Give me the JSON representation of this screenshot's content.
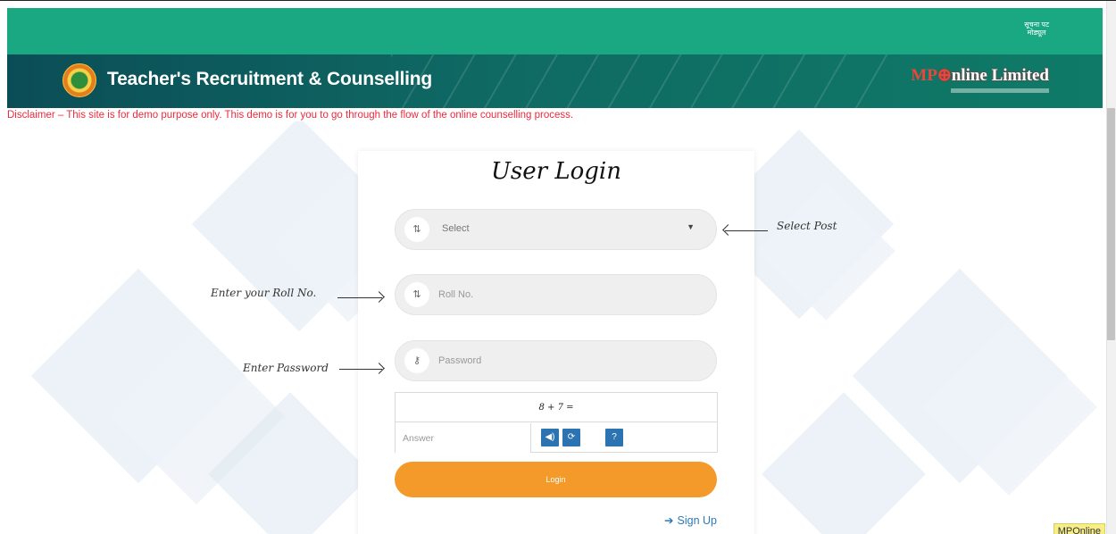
{
  "lang_link": [
    "सूचना पट",
    "मोड्यूल"
  ],
  "header": {
    "title": "Teacher's Recruitment & Counselling",
    "brand": {
      "prefix": "MP",
      "suffix": "nline Limited"
    }
  },
  "disclaimer": "Disclaimer – This site is for demo purpose only. This demo is for you to go through the flow of the online counselling process.",
  "login": {
    "title": "User Login",
    "post_select": {
      "value": "Select",
      "icon": "sort-icon"
    },
    "roll_no": {
      "placeholder": "Roll No.",
      "icon": "sort-icon"
    },
    "password": {
      "placeholder": "Password",
      "icon": "key-icon"
    },
    "captcha": {
      "question": "8 + 7 =",
      "answer_placeholder": "Answer",
      "buttons": [
        "audio-icon",
        "refresh-icon",
        "help-icon"
      ]
    },
    "login_label": "Login",
    "signup_label": "Sign Up"
  },
  "annotations": {
    "select_post": "Select Post",
    "roll_no": "Enter your Roll No.",
    "password": "Enter Password"
  },
  "footer_badge": "MPOnline",
  "colors": {
    "top_strip": "#1aa883",
    "header": "#0f6a63",
    "disclaimer": "#ee2a3d",
    "login_button": "#f39a2b",
    "captcha_buttons": "#2c74b1"
  }
}
